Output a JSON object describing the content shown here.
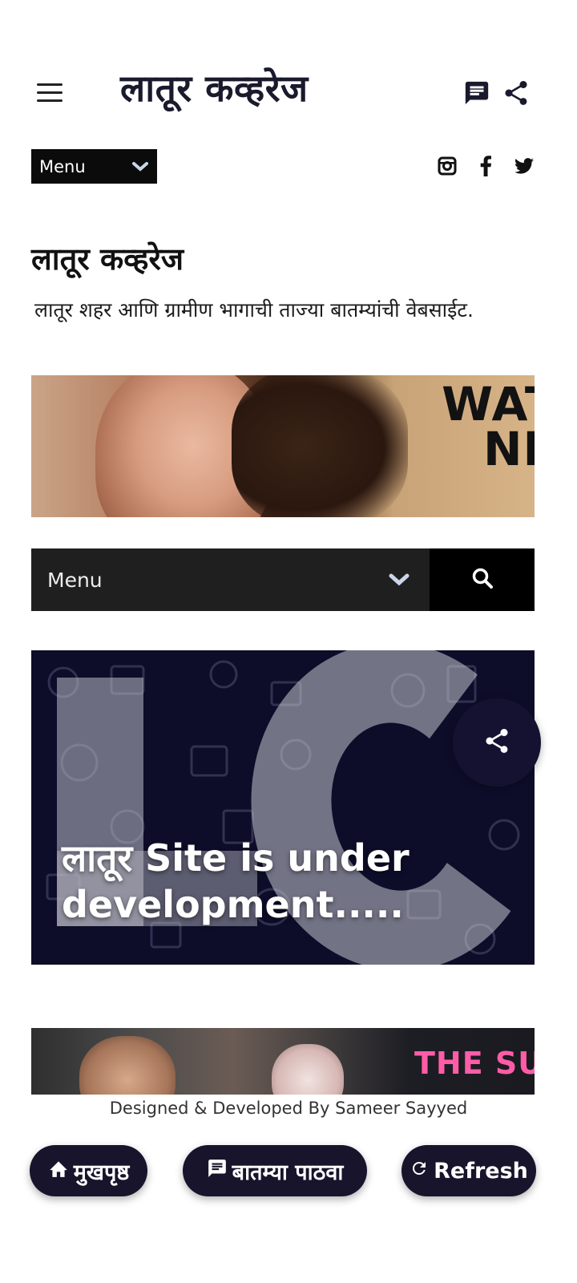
{
  "header": {
    "site_title": "लातूर कव्हरेज",
    "icons": [
      "hamburger-icon",
      "message-icon",
      "share-icon"
    ]
  },
  "menu_small": {
    "label": "Menu"
  },
  "social": [
    "instagram-icon",
    "facebook-icon",
    "twitter-icon"
  ],
  "blog": {
    "title": "लातूर कव्हरेज",
    "description": "लातूर शहर आणि ग्रामीण भागाची ताज्या बातम्यांची वेबसाईट."
  },
  "ad": {
    "text_line1": "WATC",
    "text_line2": "NEV"
  },
  "menubar": {
    "label": "Menu"
  },
  "featured_post": {
    "title": "लातूर Site is under development....."
  },
  "second_post": {
    "banner_text": "THE SU"
  },
  "footer": {
    "credit": "Designed & Developed By Sameer Sayyed"
  },
  "bottom_nav": {
    "home_label": "मुखपृष्ठ",
    "send_news_label": "बातम्या पाठवा",
    "refresh_label": "Refresh"
  },
  "colors": {
    "dark_navy": "#17142b",
    "menubar": "#1f1f1f",
    "pink_text": "#ff5ca8"
  }
}
